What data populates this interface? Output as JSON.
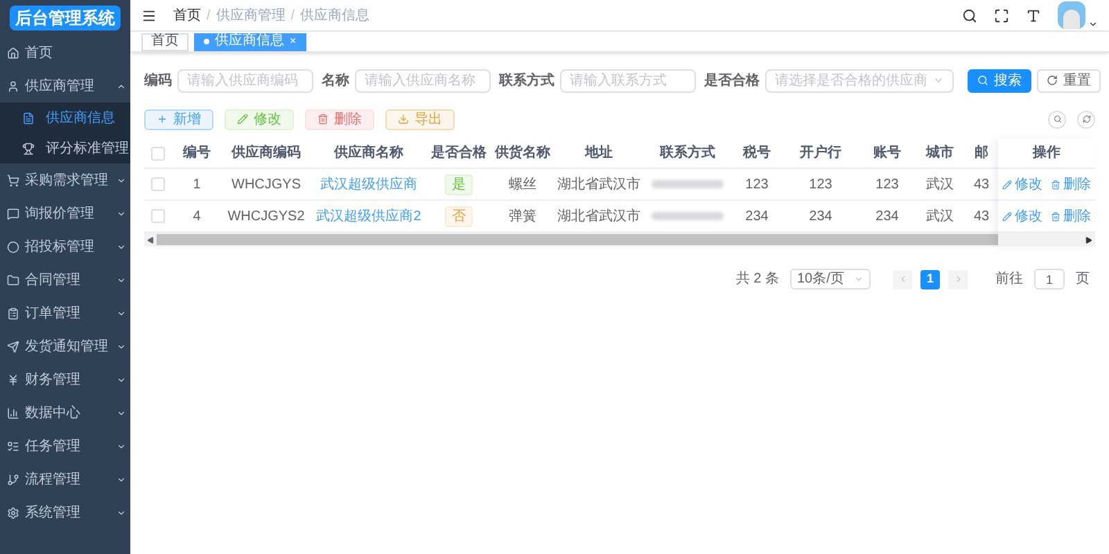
{
  "logo": "后台管理系统",
  "sidebar": {
    "items": [
      {
        "label": "首页"
      },
      {
        "label": "供应商管理",
        "expanded": true,
        "children": [
          {
            "label": "供应商信息",
            "selected": true
          },
          {
            "label": "评分标准管理",
            "selected": false
          }
        ]
      },
      {
        "label": "采购需求管理",
        "expanded": false
      },
      {
        "label": "询报价管理",
        "expanded": false
      },
      {
        "label": "招投标管理",
        "expanded": false
      },
      {
        "label": "合同管理",
        "expanded": false
      },
      {
        "label": "订单管理",
        "expanded": false
      },
      {
        "label": "发货通知管理",
        "expanded": false
      },
      {
        "label": "财务管理",
        "expanded": false
      },
      {
        "label": "数据中心",
        "expanded": false
      },
      {
        "label": "任务管理",
        "expanded": false
      },
      {
        "label": "流程管理",
        "expanded": false
      },
      {
        "label": "系统管理",
        "expanded": false
      }
    ]
  },
  "breadcrumb": [
    "首页",
    "供应商管理",
    "供应商信息"
  ],
  "breadcrumb_separator": "/",
  "tabs": [
    {
      "label": "首页",
      "selected": false
    },
    {
      "label": "供应商信息",
      "selected": true,
      "close": "×"
    }
  ],
  "search_form": {
    "fields": [
      {
        "label": "编码",
        "kind": "input",
        "placeholder": "请输入供应商编码"
      },
      {
        "label": "名称",
        "kind": "input",
        "placeholder": "请输入供应商名称"
      },
      {
        "label": "联系方式",
        "kind": "input",
        "placeholder": "请输入联系方式"
      },
      {
        "label": "是否合格",
        "kind": "select",
        "placeholder": "请选择是否合格的供应商"
      }
    ],
    "buttons": [
      {
        "label": "搜索",
        "kind": "primary"
      },
      {
        "label": "重置",
        "kind": "plain"
      }
    ]
  },
  "toolbar": [
    {
      "label": "新增",
      "kind": "add"
    },
    {
      "label": "修改",
      "kind": "edit"
    },
    {
      "label": "删除",
      "kind": "delete"
    },
    {
      "label": "导出",
      "kind": "export"
    }
  ],
  "table": {
    "header_checked": false,
    "columns": [
      "编号",
      "供应商编码",
      "供应商名称",
      "是否合格",
      "供货名称",
      "地址",
      "联系方式",
      "税号",
      "开户行",
      "账号",
      "城市",
      "邮",
      "操作"
    ],
    "rows": [
      {
        "checked": false,
        "cells": [
          "1",
          "WHCJGYS",
          "武汉超级供应商",
          "是",
          "螺丝",
          "湖北省武汉市",
          "",
          "123",
          "123",
          "123",
          "武汉",
          "43"
        ],
        "qualified": true,
        "actions": [
          "修改",
          "删除"
        ]
      },
      {
        "checked": false,
        "cells": [
          "4",
          "WHCJGYS2",
          "武汉超级供应商2",
          "否",
          "弹簧",
          "湖北省武汉市",
          "",
          "234",
          "234",
          "234",
          "武汉",
          "43"
        ],
        "qualified": false,
        "actions": [
          "修改",
          "删除"
        ]
      }
    ]
  },
  "pagination": {
    "total": "共 2 条",
    "page_size": "10条/页",
    "pages": [
      {
        "label": "1",
        "selected": true
      }
    ],
    "goto_label": "前往",
    "goto_value": "1",
    "goto_unit": "页"
  }
}
